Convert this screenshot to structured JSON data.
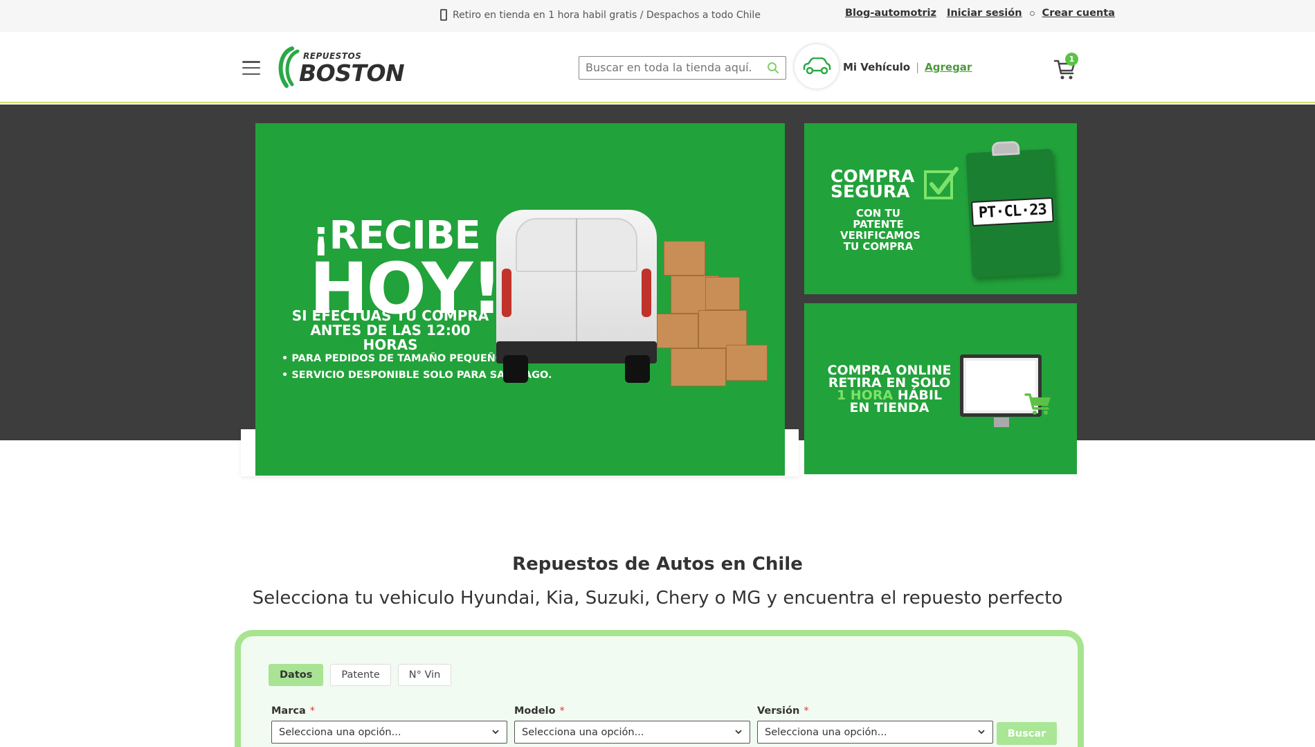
{
  "topbar": {
    "promo": "Retiro en tienda en 1 hora habil gratis / Despachos a todo Chile",
    "links": {
      "blog": "Blog-automotriz",
      "login": "Iniciar sesión",
      "signup": "Crear cuenta"
    }
  },
  "header": {
    "logo_small": "REPUESTOS",
    "logo_big": "BOSTON",
    "search_placeholder": "Buscar en toda la tienda aquí...",
    "vehicle_label": "Mi Vehículo",
    "vehicle_separator": "|",
    "vehicle_add": "Agregar",
    "cart_count": "1"
  },
  "banners": {
    "main": {
      "title1": "¡RECIBE",
      "title2": "HOY!",
      "subtitle": "SI EFECTUAS TU COMPRA ANTES DE LAS 12:00 HORAS",
      "bullet1": "• PARA PEDIDOS DE TAMAÑO PEQUEÑO.",
      "bullet2": "• SERVICIO DESPONIBLE SOLO PARA SANTIAGO."
    },
    "top_right": {
      "line1": "COMPRA",
      "line2": "SEGURA",
      "sub": "CON TU PATENTE VERIFICAMOS TU COMPRA",
      "plate": "PT·CL·23"
    },
    "bottom_right": {
      "line1": "COMPRA ONLINE",
      "line2": "RETIRA EN SOLO",
      "highlight": "1 HORA",
      "line3_rest": " HÁBIL",
      "line4": "EN TIENDA"
    }
  },
  "intro": {
    "title": "Repuestos de Autos en Chile",
    "subtitle": "Selecciona tu vehiculo Hyundai, Kia, Suzuki, Chery o MG y encuentra el repuesto perfecto"
  },
  "selector": {
    "tabs": [
      "Datos",
      "Patente",
      "N° Vin"
    ],
    "fields": [
      {
        "label": "Marca",
        "value": "Selecciona una opción..."
      },
      {
        "label": "Modelo",
        "value": "Selecciona una opción..."
      },
      {
        "label": "Versión",
        "value": "Selecciona una opción..."
      }
    ],
    "required_mark": "*",
    "button": "Buscar"
  },
  "colors": {
    "brand_green": "#22a23a",
    "accent_light_green": "#a7e48e",
    "link_green": "#4a9a3a",
    "hero_dark": "#3d3d3d"
  }
}
